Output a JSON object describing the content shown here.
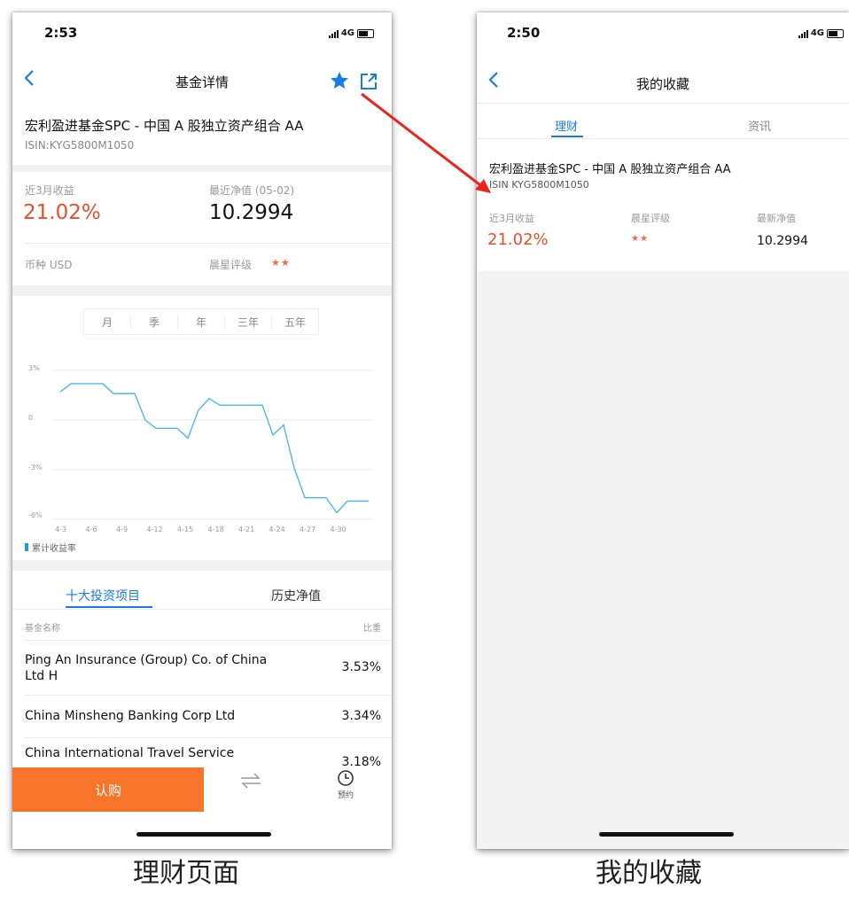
{
  "left": {
    "status": {
      "time": "2:53",
      "network": "4G"
    },
    "nav": {
      "title": "基金详情"
    },
    "fund": {
      "name": "宏利盈进基金SPC - 中国 A 股独立资产组合 AA",
      "isin": "ISIN:KYG5800M1050"
    },
    "stats": {
      "return_label": "近3月收益",
      "return_value": "21.02%",
      "nav_label": "最近净值 (05-02)",
      "nav_value": "10.2994",
      "currency": "币种 USD",
      "rating_label": "晨星评级",
      "rating_stars": "★★"
    },
    "chart_tabs": [
      "月",
      "季",
      "年",
      "三年",
      "五年"
    ],
    "chart_legend": "累计收益率",
    "holdings": {
      "tab_top10": "十大投资项目",
      "tab_history": "历史净值",
      "col_name": "基金名称",
      "col_weight": "比重",
      "rows": [
        {
          "name": "Ping An Insurance (Group) Co. of China Ltd H",
          "weight": "3.53%"
        },
        {
          "name": "China Minsheng Banking Corp Ltd",
          "weight": "3.34%"
        },
        {
          "name": "China International Travel Service",
          "weight": "3.18%"
        }
      ]
    },
    "bottom_bar": {
      "buy": "认购",
      "reserve": "预约"
    },
    "colors": {
      "accent": "#1a7be0",
      "red": "#e8502d",
      "buy_orange": "#f7752a",
      "line": "#4db8e8"
    }
  },
  "right": {
    "status": {
      "time": "2:50",
      "network": "4G"
    },
    "nav": {
      "title": "我的收藏"
    },
    "tabs": [
      "理财",
      "资讯"
    ],
    "item": {
      "name": "宏利盈进基金SPC - 中国 A 股独立资产组合 AA",
      "isin": "ISIN  KYG5800M1050",
      "return_label": "近3月收益",
      "return_value": "21.02%",
      "rating_label": "晨星评级",
      "rating_stars": "★★",
      "nav_label": "最新净值",
      "nav_value": "10.2994"
    }
  },
  "captions": {
    "left": "理财页面",
    "right": "我的收藏"
  },
  "chart_data": {
    "type": "line",
    "title": "",
    "xlabel": "",
    "ylabel": "",
    "x_ticks": [
      "4-3",
      "4-6",
      "4-9",
      "4-12",
      "4-15",
      "4-18",
      "4-21",
      "4-24",
      "4-27",
      "4-30"
    ],
    "y_ticks": [
      "3%",
      "0",
      "-3%",
      "-6%"
    ],
    "ylim": [
      -6,
      3
    ],
    "xlim": [
      3,
      32
    ],
    "grid": true,
    "legend": "bottom-left",
    "series": [
      {
        "name": "累计收益率",
        "x": [
          3,
          4,
          5,
          6,
          7,
          8,
          9,
          10,
          11,
          12,
          13,
          14,
          15,
          16,
          17,
          18,
          19,
          20,
          21,
          22,
          23,
          24,
          25,
          26,
          27,
          28,
          29,
          30,
          31,
          32
        ],
        "values": [
          1.7,
          2.2,
          2.2,
          2.2,
          2.2,
          1.6,
          1.6,
          1.6,
          0,
          -0.5,
          -0.5,
          -0.5,
          -1.1,
          0.6,
          1.3,
          0.9,
          0.9,
          0.9,
          0.9,
          0.9,
          -0.9,
          -0.3,
          -2.9,
          -4.7,
          -4.7,
          -4.7,
          -5.6,
          -4.9,
          -4.9,
          -4.9
        ]
      }
    ]
  }
}
